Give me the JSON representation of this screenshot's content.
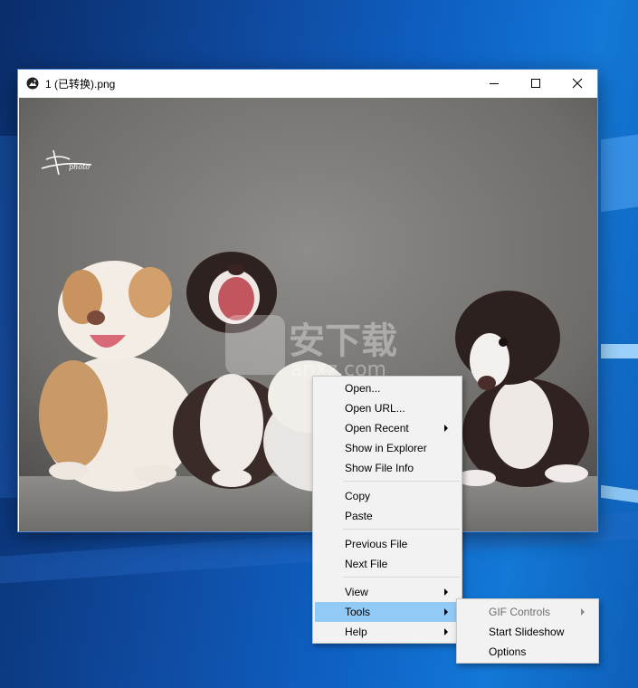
{
  "window": {
    "title": "1 (已转换).png",
    "controls": {
      "minimize": "minimize",
      "maximize": "maximize",
      "close": "close"
    }
  },
  "photo": {
    "signature": "photo",
    "watermark_text": "安下载",
    "watermark_sub": "anxz.com"
  },
  "context_menu": {
    "items": [
      {
        "label": "Open..."
      },
      {
        "label": "Open URL..."
      },
      {
        "label": "Open Recent",
        "submenu": true
      },
      {
        "label": "Show in Explorer"
      },
      {
        "label": "Show File Info"
      },
      {
        "label": "Copy"
      },
      {
        "label": "Paste"
      },
      {
        "label": "Previous File"
      },
      {
        "label": "Next File"
      },
      {
        "label": "View",
        "submenu": true
      },
      {
        "label": "Tools",
        "submenu": true,
        "highlighted": true
      },
      {
        "label": "Help",
        "submenu": true
      }
    ]
  },
  "tools_submenu": {
    "items": [
      {
        "label": "GIF Controls",
        "submenu": true,
        "disabled": true
      },
      {
        "label": "Start Slideshow"
      },
      {
        "label": "Options"
      }
    ]
  },
  "colors": {
    "menu_highlight": "#91c9f7",
    "menu_background": "#f2f2f2",
    "desktop": "#0e61c4"
  }
}
